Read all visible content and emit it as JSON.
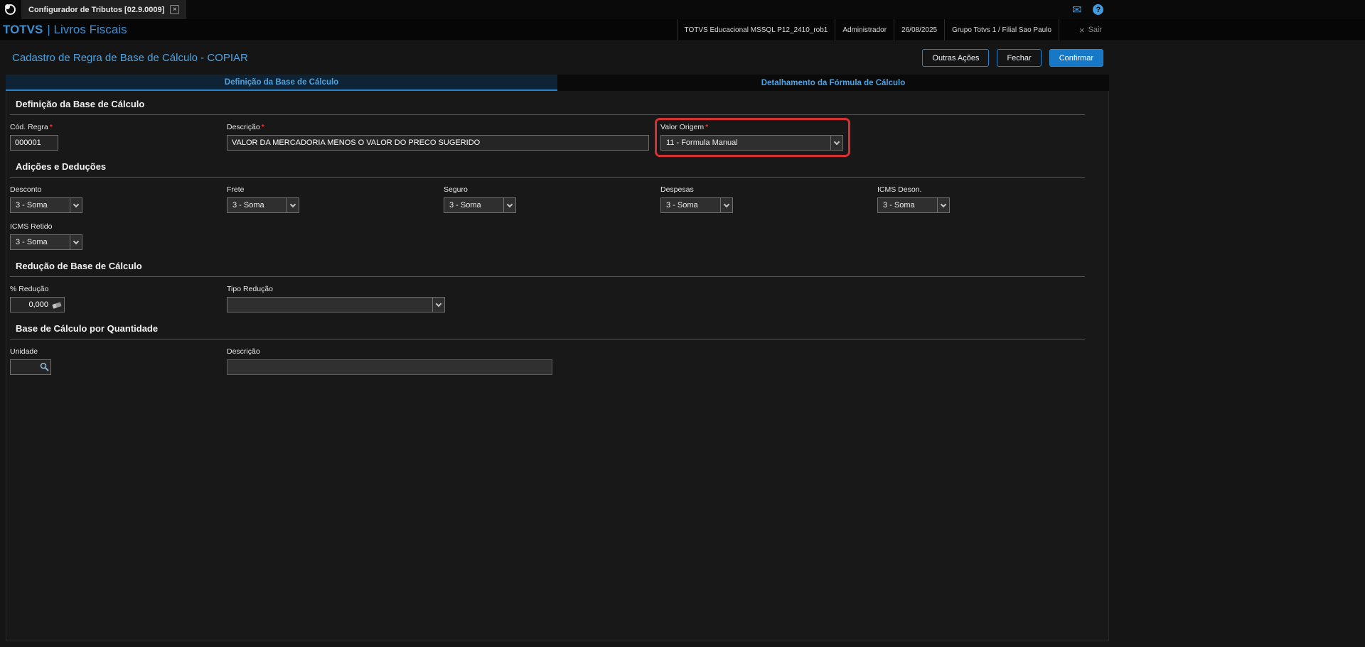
{
  "ui": {
    "required_marker": "*"
  },
  "icons": {
    "mail_glyph": "✉",
    "help_glyph": "?",
    "close_glyph": "×",
    "exit_glyph": "×"
  },
  "colors": {
    "accent_blue": "#4da3e0",
    "brand_blue": "#3d8fd0",
    "section_line": "#1565a0",
    "confirm_button": "#1878c8",
    "annotation_red": "#d83030"
  },
  "window": {
    "tab_title": "Configurador de Tributos [02.9.0009]"
  },
  "header": {
    "brand_name": "TOTVS",
    "brand_module": "| Livros Fiscais",
    "environment": "TOTVS Educacional MSSQL P12_2410_rob1",
    "user": "Administrador",
    "date": "26/08/2025",
    "company": "Grupo Totvs 1 / Filial Sao Paulo",
    "exit_label": "Sair"
  },
  "page": {
    "title": "Cadastro de Regra de Base de Cálculo - COPIAR",
    "buttons": {
      "other_actions": "Outras Ações",
      "close": "Fechar",
      "confirm": "Confirmar"
    }
  },
  "tabs": [
    {
      "label": "Definição da Base de Cálculo",
      "active": true
    },
    {
      "label": "Detalhamento da Fórmula de Cálculo",
      "active": false
    }
  ],
  "sections": {
    "definicao": {
      "title": "Definição da Base de Cálculo",
      "fields": {
        "cod_regra": {
          "label": "Cód. Regra",
          "required": true,
          "value": "000001"
        },
        "descricao": {
          "label": "Descrição",
          "required": true,
          "value": "VALOR DA MERCADORIA MENOS O VALOR DO PRECO SUGERIDO"
        },
        "valor_origem": {
          "label": "Valor Origem",
          "required": true,
          "value": "11 - Formula Manual"
        }
      }
    },
    "adicoes_deducoes": {
      "title": "Adições e Deduções",
      "fields": {
        "desconto": {
          "label": "Desconto",
          "value": "3 - Soma"
        },
        "frete": {
          "label": "Frete",
          "value": "3 - Soma"
        },
        "seguro": {
          "label": "Seguro",
          "value": "3 - Soma"
        },
        "despesas": {
          "label": "Despesas",
          "value": "3 - Soma"
        },
        "icms_deson": {
          "label": "ICMS Deson.",
          "value": "3 - Soma"
        },
        "icms_retido": {
          "label": "ICMS Retido",
          "value": "3 - Soma"
        }
      }
    },
    "reducao": {
      "title": "Redução de Base de Cálculo",
      "fields": {
        "perc_reducao": {
          "label": "% Redução",
          "value": "0,000"
        },
        "tipo_reducao": {
          "label": "Tipo Redução",
          "value": ""
        }
      }
    },
    "quantidade": {
      "title": "Base de Cálculo por Quantidade",
      "fields": {
        "unidade": {
          "label": "Unidade",
          "value": ""
        },
        "descricao": {
          "label": "Descrição",
          "value": ""
        }
      }
    }
  }
}
